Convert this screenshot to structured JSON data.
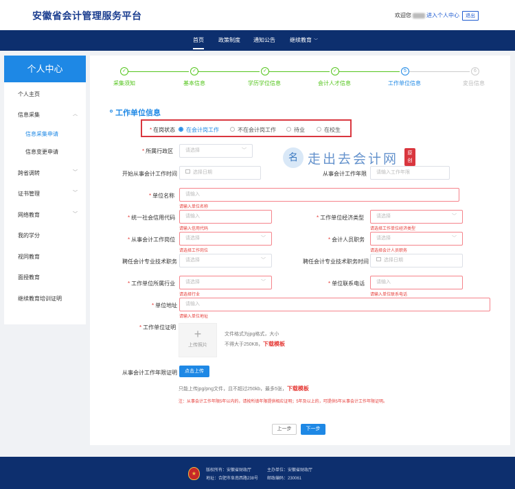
{
  "header": {
    "brand": "安徽省会计管理服务平台",
    "welcome_prefix": "欢迎您",
    "personal_link": "进入个人中心",
    "logout": "退出"
  },
  "nav": {
    "items": [
      {
        "label": "首页",
        "active": true
      },
      {
        "label": "政策制度"
      },
      {
        "label": "通知公告"
      },
      {
        "label": "继续教育",
        "has_dropdown": true
      }
    ]
  },
  "sidebar": {
    "title": "个人中心",
    "items": [
      {
        "label": "个人主页"
      },
      {
        "label": "信息采集",
        "expanded": true
      },
      {
        "label": "信息采集申请",
        "sub": true,
        "active": true
      },
      {
        "label": "信息变更申请",
        "sub": true
      },
      {
        "label": "跨省调转",
        "collapsible": true
      },
      {
        "label": "证书管理",
        "collapsible": true
      },
      {
        "label": "网络教育",
        "collapsible": true
      },
      {
        "label": "我的学分"
      },
      {
        "label": "视同教育"
      },
      {
        "label": "面授教育"
      },
      {
        "label": "继续教育培训证明"
      }
    ]
  },
  "steps": {
    "current": 5,
    "items": [
      {
        "label": "采集须知",
        "state": "done",
        "num": "1"
      },
      {
        "label": "基本信息",
        "state": "done",
        "num": "2"
      },
      {
        "label": "学历学位信息",
        "state": "done",
        "num": "3"
      },
      {
        "label": "会计人才信息",
        "state": "done",
        "num": "4"
      },
      {
        "label": "工作单位信息",
        "state": "current",
        "num": "5"
      },
      {
        "label": "変岳信息",
        "state": "todo",
        "num": "6"
      }
    ],
    "done_mark": "✓"
  },
  "section": {
    "title": "工作单位信息"
  },
  "form": {
    "status": {
      "label": "在岗状态",
      "options": [
        {
          "label": "在会计岗工作",
          "checked": true
        },
        {
          "label": "不在会计岗工作"
        },
        {
          "label": "待业"
        },
        {
          "label": "在校生"
        }
      ]
    },
    "region": {
      "label": "所属行政区",
      "placeholder": "请选择"
    },
    "start_time": {
      "label": "开始从事会计工作时间",
      "placeholder": "选择日期"
    },
    "years": {
      "label": "从事会计工作年限",
      "placeholder": "请输入工作年限"
    },
    "unit_name": {
      "label": "单位名称",
      "placeholder": "请输入",
      "error": "请输入单位名称"
    },
    "credit_code": {
      "label": "统一社会信用代码",
      "placeholder": "请输入",
      "error": "请输入信用代码"
    },
    "econ_type": {
      "label": "工作单位经济类型",
      "placeholder": "请选择",
      "error": "请选择工作单位经济类型"
    },
    "post": {
      "label": "从事会计工作岗位",
      "placeholder": "请选择",
      "error": "请选择工作岗位"
    },
    "staff_duty": {
      "label": "会计人员职务",
      "placeholder": "请选择",
      "error": "请选择会计人员职务"
    },
    "tech_post": {
      "label": "聘任会计专业技术职务",
      "placeholder": "请选择"
    },
    "tech_time": {
      "label": "聘任会计专业技术职务时间",
      "placeholder": "选择日期"
    },
    "industry": {
      "label": "工作单位所属行业",
      "placeholder": "请选择",
      "error": "请选择行业"
    },
    "phone": {
      "label": "单位联系电话",
      "placeholder": "请输入",
      "error": "请输入单位联系电话"
    },
    "address": {
      "label": "单位地址",
      "placeholder": "请输入",
      "error": "请输入单位地址"
    },
    "proof": {
      "label": "工作单位证明",
      "upload_text": "上传照片",
      "hint_line1": "文件格式为jpg格式，大小",
      "hint_line2": "不得大于250KB，",
      "download": "下载模板"
    },
    "years_proof": {
      "label": "从事会计工作年限证明",
      "button": "点击上传",
      "hint": "只能上传jpg/png文件，且不超过250kb，最多5张，",
      "download": "下载模板",
      "note": "注：从事会计工作年限5年以内的，请按所填年限提供相应证明；5年及以上的，可提供5年从事会计工作年限证明。"
    }
  },
  "actions": {
    "prev": "上一步",
    "next": "下一步"
  },
  "watermark": {
    "text": "走出去会计网",
    "logo": "名",
    "seal_line1": "原",
    "seal_line2": "创"
  },
  "footer": {
    "owner": "版权所有：安徽省财政厅",
    "sponsor": "主办单位：安徽省财政厅",
    "address": "地址：合肥市阜南西路238号",
    "postcode": "邮政编码：230061",
    "emblem": "★"
  }
}
